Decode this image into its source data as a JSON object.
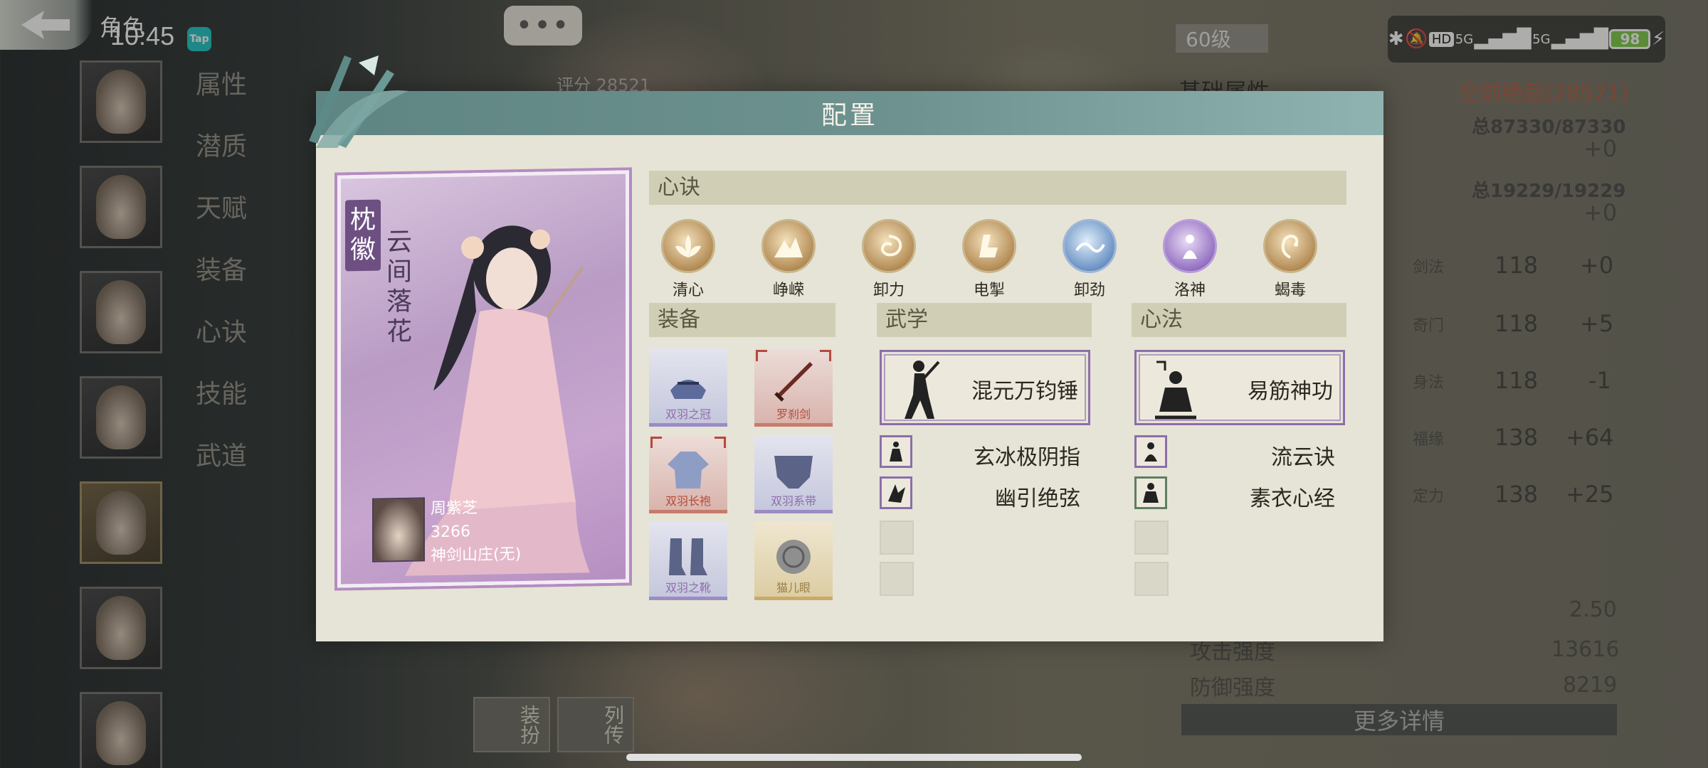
{
  "status_bar": {
    "time": "10:45",
    "tap_badge": "Tap",
    "network": "5G",
    "network2": "5G",
    "battery": "98",
    "hd": "HD"
  },
  "screen": {
    "title": "角色",
    "menu": [
      "属性",
      "潜质",
      "天赋",
      "装备",
      "心诀",
      "技能",
      "武道"
    ],
    "rating_label": "评分",
    "rating_value": "28521",
    "chat": "•••"
  },
  "right_panel": {
    "level": "60级",
    "base_attr_label": "基础属性",
    "rating_text": "空前绝后(28521)",
    "hp_total": "总87330/87330",
    "hp_delta": "+0",
    "mp_total": "总19229/19229",
    "mp_delta": "+0",
    "stats": [
      {
        "label": "剑法",
        "value": "118",
        "delta": "+0"
      },
      {
        "label": "奇门",
        "value": "118",
        "delta": "+5"
      },
      {
        "label": "身法",
        "value": "118",
        "delta": "-1"
      },
      {
        "label": "福缘",
        "value": "138",
        "delta": "+64"
      },
      {
        "label": "定力",
        "value": "138",
        "delta": "+25"
      }
    ],
    "misc": [
      {
        "label": "",
        "value": "2.50"
      },
      {
        "label": "攻击强度",
        "value": "13616"
      },
      {
        "label": "防御强度",
        "value": "8219"
      }
    ],
    "more_button": "更多详情"
  },
  "bottom_tabs": [
    "装扮",
    "列传"
  ],
  "dialog": {
    "title": "配置",
    "card": {
      "title": "枕徽",
      "subtitle": "云间落花",
      "owner_name": "周紫芝",
      "owner_power": "3266",
      "owner_sect": "神剑山庄(无)"
    },
    "xinjue_header": "心诀",
    "xinjue": [
      {
        "name": "清心",
        "style": "gold",
        "icon": "lotus-icon"
      },
      {
        "name": "峥嵘",
        "style": "gold",
        "icon": "mountain-icon"
      },
      {
        "name": "卸力",
        "style": "gold",
        "icon": "swirl-icon"
      },
      {
        "name": "电掣",
        "style": "gold",
        "icon": "lightning-icon"
      },
      {
        "name": "卸劲",
        "style": "blue",
        "icon": "wave-icon"
      },
      {
        "name": "洛神",
        "style": "purple",
        "icon": "goddess-icon"
      },
      {
        "name": "蝎毒",
        "style": "gold",
        "icon": "scorpion-icon"
      }
    ],
    "equip_header": "装备",
    "equipment": [
      {
        "name": "双羽之冠",
        "rarity": "blue",
        "icon": "crown-icon"
      },
      {
        "name": "罗刹剑",
        "rarity": "red",
        "icon": "sword-icon"
      },
      {
        "name": "双羽长袍",
        "rarity": "red",
        "icon": "robe-icon"
      },
      {
        "name": "双羽系带",
        "rarity": "blue",
        "icon": "belt-icon"
      },
      {
        "name": "双羽之靴",
        "rarity": "blue",
        "icon": "boots-icon"
      },
      {
        "name": "猫儿眼",
        "rarity": "gold",
        "icon": "gem-icon"
      }
    ],
    "wuxue_header": "武学",
    "wuxue_main": "混元万钧锤",
    "wuxue_sub": [
      "玄冰极阴指",
      "幽引绝弦"
    ],
    "xinfa_header": "心法",
    "xinfa_main": "易筋神功",
    "xinfa_sub": [
      "流云诀",
      "素衣心经"
    ]
  },
  "colors": {
    "header_teal": "#6d9290",
    "panel_bg": "#e6e4d6",
    "section_bg": "#d0ceb4",
    "purple_frame": "#8c6fa8",
    "card_purple": "#b99bc4"
  }
}
